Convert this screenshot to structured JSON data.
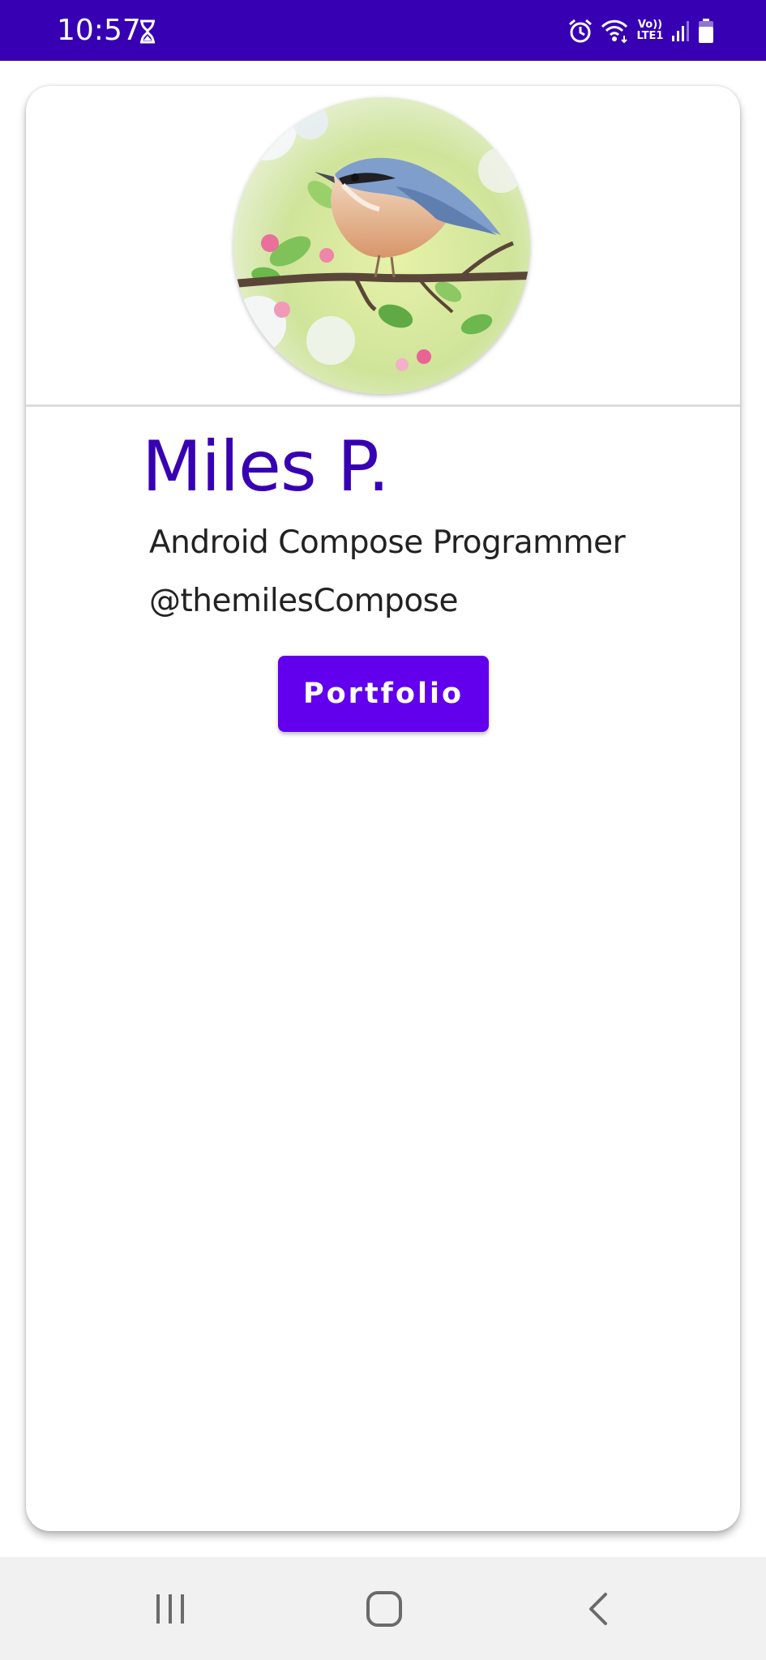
{
  "status_bar": {
    "time": "10:57",
    "volte_line1": "Vo))",
    "volte_line2": "LTE1",
    "background_color": "#3700b3"
  },
  "profile": {
    "name": "Miles P.",
    "title": "Android Compose Programmer",
    "handle": "@themilesCompose",
    "avatar_alt": "bird on blossoming branch",
    "name_color": "#3700b3"
  },
  "actions": {
    "portfolio_label": "Portfolio",
    "button_color": "#6200ee"
  },
  "nav_bar": {
    "recents_icon": "recents-icon",
    "home_icon": "home-icon",
    "back_icon": "back-icon"
  }
}
